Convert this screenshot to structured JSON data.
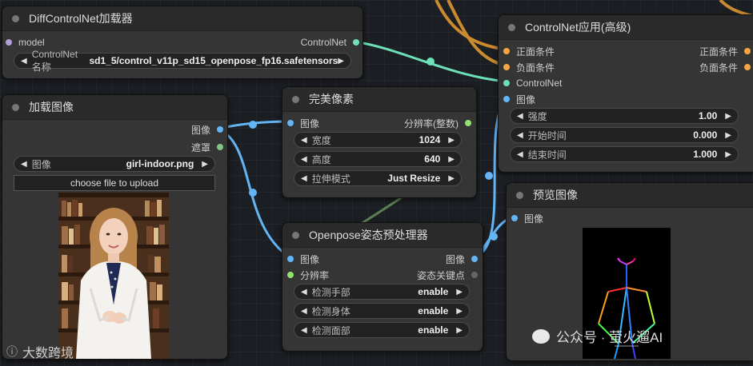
{
  "nodes": {
    "diff_controlnet": {
      "title": "DiffControlNet加载器",
      "input_model": "model",
      "output_controlnet": "ControlNet",
      "widget_label": "ControlNet名称",
      "widget_value": "sd1_5/control_v11p_sd15_openpose_fp16.safetensors"
    },
    "load_image": {
      "title": "加载图像",
      "output_image": "图像",
      "output_mask": "遮罩",
      "widget_label": "图像",
      "widget_value": "girl-indoor.png",
      "upload_button": "choose file to upload"
    },
    "perfect_pixel": {
      "title": "完美像素",
      "input_image": "图像",
      "output_resolution": "分辨率(整数)",
      "widgets": [
        {
          "label": "宽度",
          "value": "1024"
        },
        {
          "label": "高度",
          "value": "640"
        },
        {
          "label": "拉伸模式",
          "value": "Just Resize"
        }
      ]
    },
    "controlnet_apply": {
      "title": "ControlNet应用(高级)",
      "inputs": [
        "正面条件",
        "负面条件",
        "ControlNet",
        "图像"
      ],
      "outputs": [
        "正面条件",
        "负面条件"
      ],
      "widgets": [
        {
          "label": "强度",
          "value": "1.00"
        },
        {
          "label": "开始时间",
          "value": "0.000"
        },
        {
          "label": "结束时间",
          "value": "1.000"
        }
      ]
    },
    "preview_image": {
      "title": "预览图像",
      "input_image": "图像"
    },
    "openpose": {
      "title": "Openpose姿态预处理器",
      "input_image": "图像",
      "input_resolution": "分辨率",
      "output_image": "图像",
      "output_keypoints": "姿态关键点",
      "widgets": [
        {
          "label": "检测手部",
          "value": "enable"
        },
        {
          "label": "检测身体",
          "value": "enable"
        },
        {
          "label": "检测面部",
          "value": "enable"
        }
      ]
    }
  },
  "watermarks": {
    "bottom_left": "大数跨境",
    "bottom_right": "公众号 · 萤火遛AI"
  },
  "colors": {
    "conditioning": "#f5a742",
    "controlnet": "#6ee0b8",
    "image": "#64b5f6",
    "model": "#b39ddb",
    "mask": "#81c784",
    "int": "#8fe36f"
  }
}
